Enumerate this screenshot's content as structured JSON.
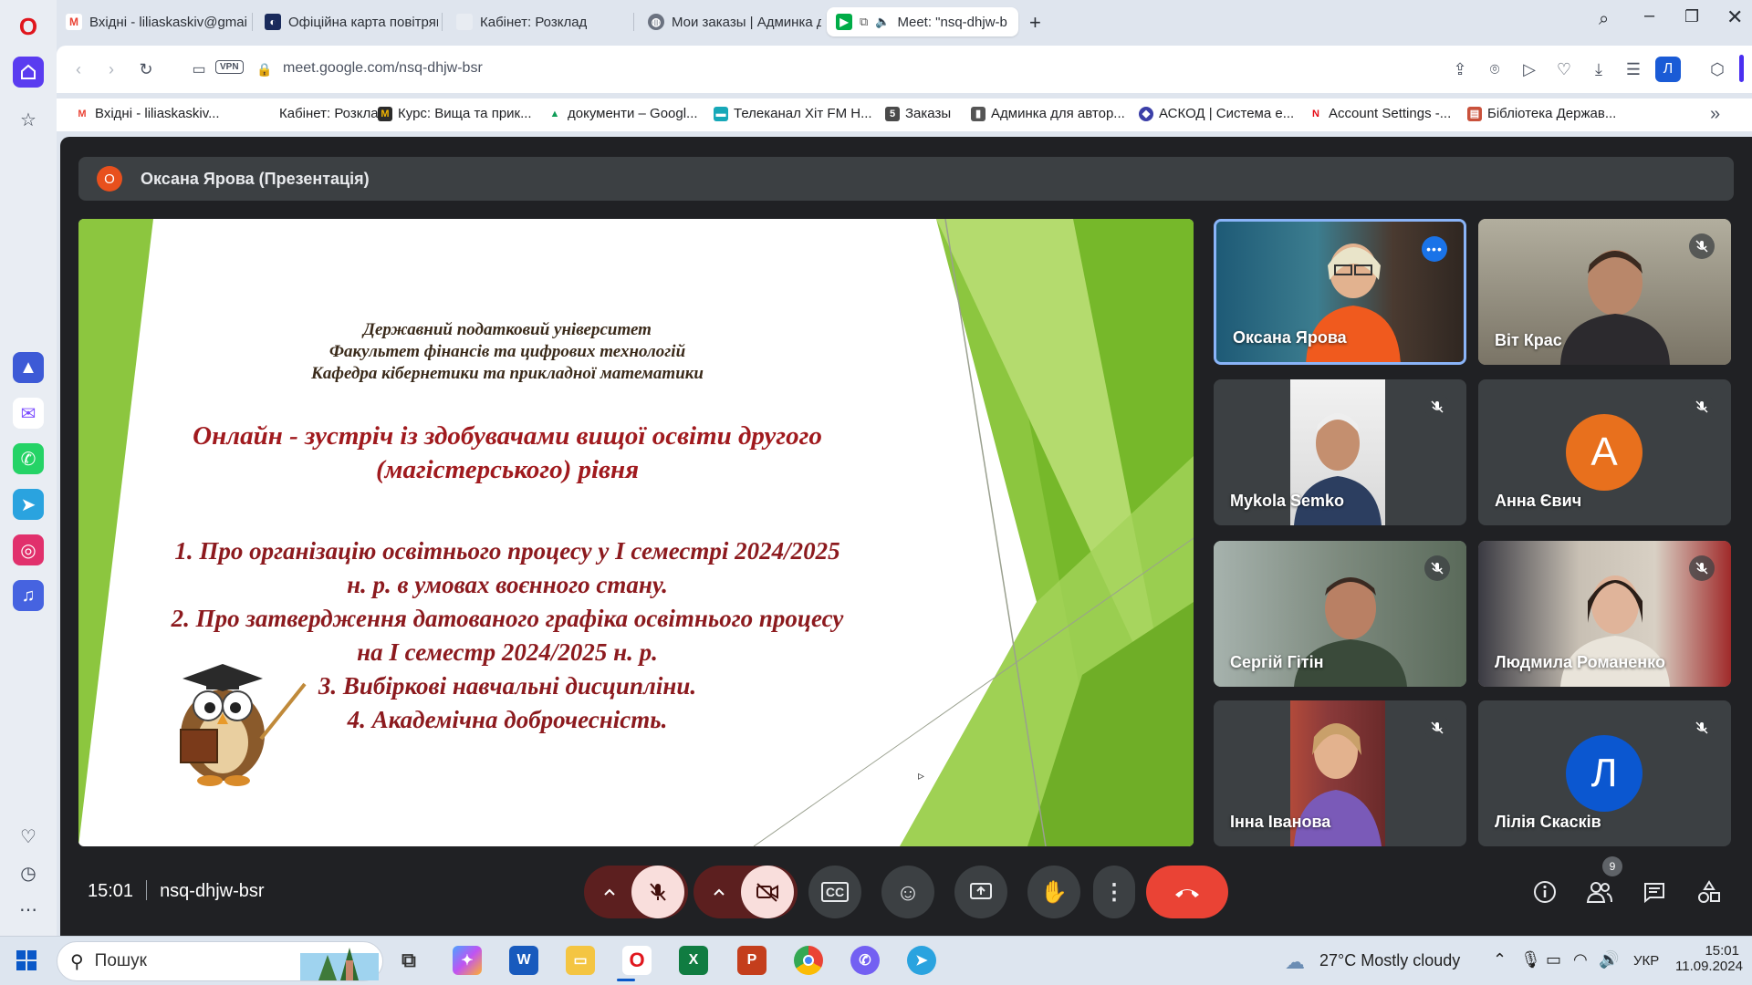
{
  "browser": {
    "tabs": [
      {
        "label": "Вхідні - liliaskaskiv@gmail",
        "icon": "gmail-icon"
      },
      {
        "label": "Офіційна карта повітряних",
        "icon": "alert-map-icon"
      },
      {
        "label": "Кабінет: Розклад",
        "icon": "page-icon"
      },
      {
        "label": "Мои заказы | Админка д",
        "icon": "globe-icon"
      },
      {
        "label": "Meet: \"nsq-dhjw-b",
        "icon": "meet-icon"
      }
    ],
    "url": "meet.google.com/nsq-dhjw-bsr",
    "vpn_label": "VPN",
    "profile_letter": "Л",
    "bookmarks": [
      "Вхідні - liliaskaskiv...",
      "Кабінет: Розклад",
      "Курс: Вища та прик...",
      "документи – Googl...",
      "Телеканал Хіт FM Н...",
      "Заказы",
      "Админка для автор...",
      "АСКОД | Система е...",
      "Account Settings -...",
      "Бібліотека Держав..."
    ]
  },
  "meet": {
    "presenter_initial": "О",
    "presenter_label": "Оксана Ярова (Презентація)",
    "slide": {
      "header": [
        "Державний податковий університет",
        "Факультет фінансів та цифрових технологій",
        "Кафедра кібернетики та прикладної математики"
      ],
      "title": [
        "Онлайн - зустріч із здобувачами вищої освіти другого",
        "(магістерського) рівня"
      ],
      "items": [
        "1. Про організацію освітнього процесу у І семестрі 2024/2025",
        "н. р. в умовах воєнного стану.",
        "2. Про затвердження датованого графіка освітнього процесу",
        "на І семестр 2024/2025 н. р.",
        "3. Вибіркові навчальні дисципліни.",
        "4. Академічна доброчесність."
      ]
    },
    "participants": [
      {
        "name": "Оксана Ярова",
        "muted": false
      },
      {
        "name": "Віт Крас",
        "muted": true
      },
      {
        "name": "Mykola Semko",
        "muted": true
      },
      {
        "name": "Анна Євич",
        "muted": true,
        "initial": "А"
      },
      {
        "name": "Сергій Гітін",
        "muted": true
      },
      {
        "name": "Людмила Романенко",
        "muted": true
      },
      {
        "name": "Інна Іванова",
        "muted": true
      },
      {
        "name": "Лілія Скасків",
        "muted": true,
        "initial": "Л"
      }
    ],
    "time": "15:01",
    "meeting_code": "nsq-dhjw-bsr",
    "people_count": "9"
  },
  "taskbar": {
    "search_placeholder": "Пошук",
    "weather": "27°C  Mostly cloudy",
    "language": "УКР",
    "time": "15:01",
    "date": "11.09.2024"
  },
  "colors": {
    "meet_bg": "#202124",
    "end_call": "#ea4335",
    "muted_red": "#f9dedc",
    "accent_orange": "#e8501d"
  }
}
